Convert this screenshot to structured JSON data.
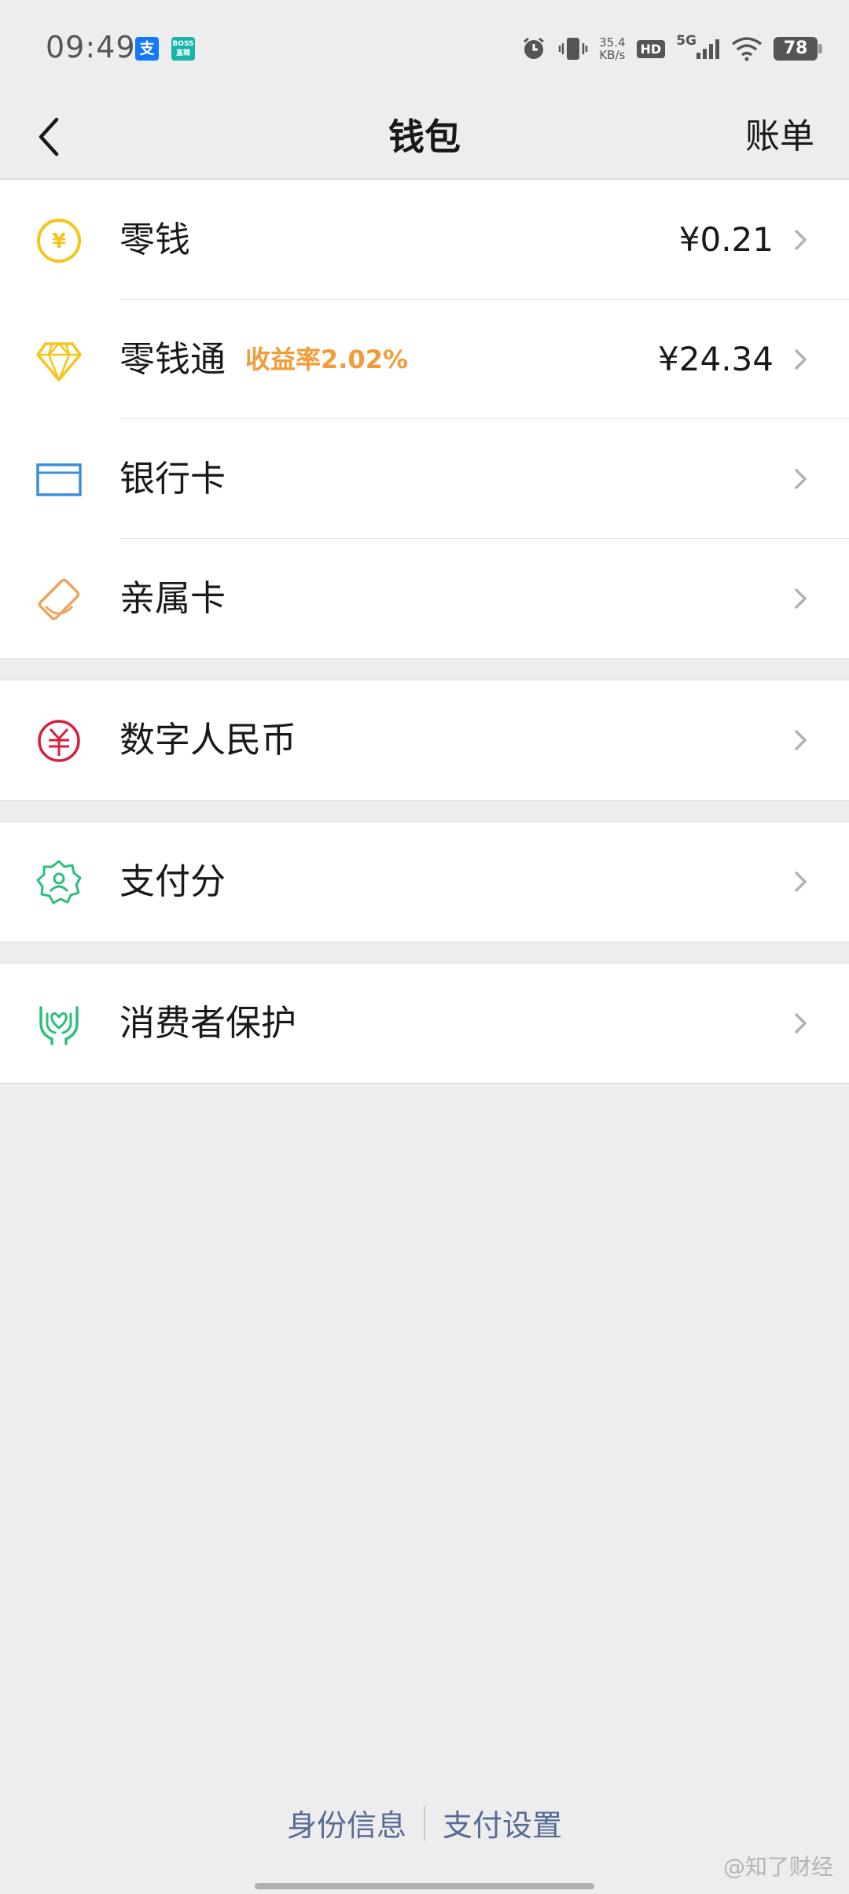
{
  "status_bar": {
    "time": "09:49",
    "alipay_badge": "支",
    "boss_badge": "BOSS 直聘",
    "net_speed_value": "35.4",
    "net_speed_unit": "KB/s",
    "hd": "HD",
    "network": "5G",
    "battery": "78"
  },
  "nav": {
    "title": "钱包",
    "right_label": "账单"
  },
  "groups": [
    {
      "items": [
        {
          "label": "零钱",
          "value": "¥0.21",
          "icon": "coin-icon",
          "color": "#f5c518"
        },
        {
          "label": "零钱通",
          "sub": "收益率2.02%",
          "value": "¥24.34",
          "icon": "diamond-icon",
          "color": "#f5c518"
        },
        {
          "label": "银行卡",
          "icon": "bank-card-icon",
          "color": "#3c8ed8"
        },
        {
          "label": "亲属卡",
          "icon": "family-card-icon",
          "color": "#f0a35a"
        }
      ]
    },
    {
      "items": [
        {
          "label": "数字人民币",
          "icon": "digital-rmb-icon",
          "color": "#d81e3a"
        }
      ]
    },
    {
      "items": [
        {
          "label": "支付分",
          "icon": "pay-score-icon",
          "color": "#2dbf7a"
        }
      ]
    },
    {
      "items": [
        {
          "label": "消费者保护",
          "icon": "consumer-protection-icon",
          "color": "#2dbf7a"
        }
      ]
    }
  ],
  "footer": {
    "identity_link": "身份信息",
    "settings_link": "支付设置",
    "watermark": "@知了财经"
  }
}
